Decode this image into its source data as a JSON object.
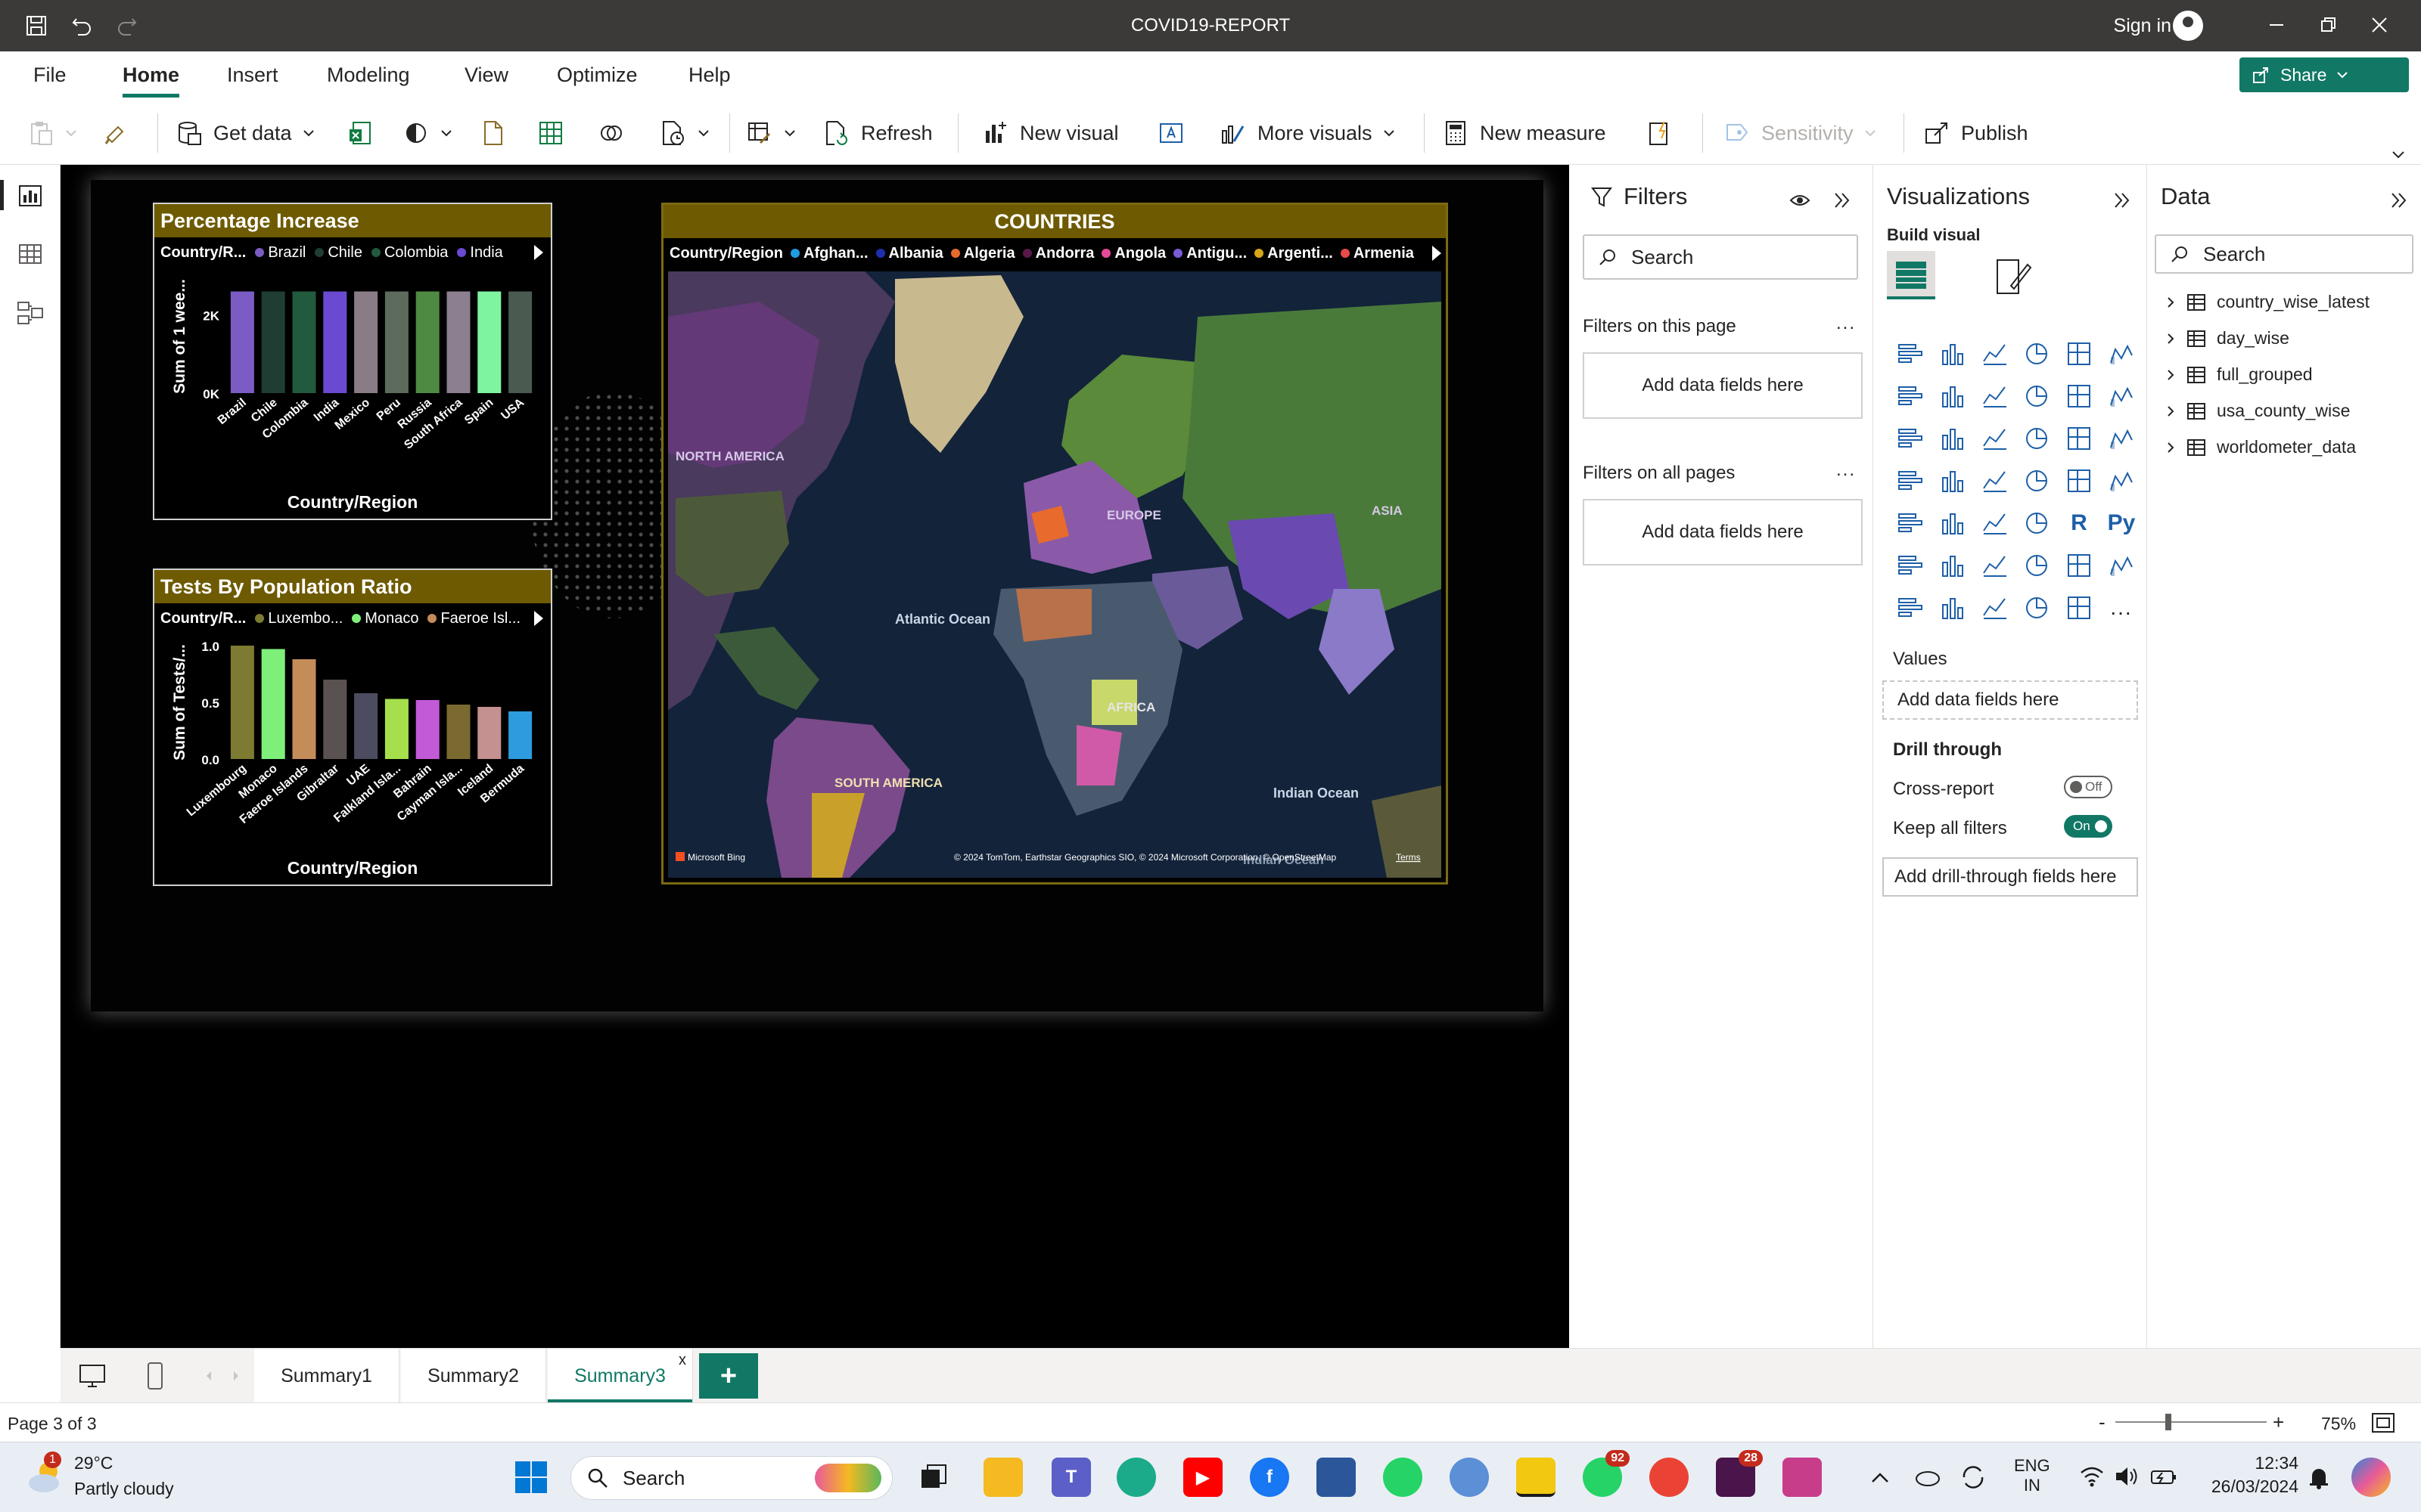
{
  "window": {
    "title": "COVID19-REPORT",
    "sign_in": "Sign in"
  },
  "menu": {
    "tabs": [
      "File",
      "Home",
      "Insert",
      "Modeling",
      "View",
      "Optimize",
      "Help"
    ],
    "active": "Home",
    "share_label": "Share"
  },
  "ribbon": {
    "get_data": "Get data",
    "refresh": "Refresh",
    "new_visual": "New visual",
    "more_visuals": "More visuals",
    "new_measure": "New measure",
    "sensitivity": "Sensitivity",
    "publish": "Publish"
  },
  "visuals": {
    "percentage": {
      "title": "Percentage Increase",
      "legend_title": "Country/R...",
      "legend": [
        {
          "name": "Brazil",
          "color": "#7b5cc4"
        },
        {
          "name": "Chile",
          "color": "#1f3d33"
        },
        {
          "name": "Colombia",
          "color": "#215a3c"
        },
        {
          "name": "India",
          "color": "#6a4ad1"
        }
      ],
      "y_axis_label": "Sum of 1 wee...",
      "x_axis_label": "Country/Region",
      "y_ticks": [
        "2K",
        "0K"
      ]
    },
    "tests": {
      "title": "Tests By Population Ratio",
      "legend_title": "Country/R...",
      "legend": [
        {
          "name": "Luxembo...",
          "color": "#7d7a32"
        },
        {
          "name": "Monaco",
          "color": "#7ef07a"
        },
        {
          "name": "Faeroe Isl...",
          "color": "#c48c59"
        }
      ],
      "y_axis_label": "Sum of Tests/...",
      "x_axis_label": "Country/Region",
      "y_ticks": [
        "1.0",
        "0.5",
        "0.0"
      ]
    },
    "map": {
      "title": "COUNTRIES",
      "legend_title": "Country/Region",
      "legend": [
        {
          "name": "Afghan...",
          "color": "#1f9be0"
        },
        {
          "name": "Albania",
          "color": "#1e2fae"
        },
        {
          "name": "Algeria",
          "color": "#e86a2c"
        },
        {
          "name": "Andorra",
          "color": "#5a1848"
        },
        {
          "name": "Angola",
          "color": "#e84a9a"
        },
        {
          "name": "Antigu...",
          "color": "#7a5ad6"
        },
        {
          "name": "Argenti...",
          "color": "#d4a618"
        },
        {
          "name": "Armenia",
          "color": "#e84a4a"
        }
      ],
      "labels": {
        "north_america": "NORTH AMERICA",
        "europe": "EUROPE",
        "asia": "ASIA",
        "atlantic": "Atlantic Ocean",
        "africa": "AFRICA",
        "south_america": "SOUTH AMERICA",
        "indian": "Indian Ocean",
        "indian2": "Indian Ocean"
      },
      "bing": "Microsoft Bing",
      "attribution": "© 2024 TomTom, Earthstar Geographics SIO, © 2024 Microsoft Corporation, © OpenStreetMap",
      "terms": "Terms"
    }
  },
  "chart_data": [
    {
      "type": "bar",
      "title": "Percentage Increase",
      "xlabel": "Country/Region",
      "ylabel": "Sum of 1 wee...",
      "categories": [
        "Brazil",
        "Chile",
        "Colombia",
        "India",
        "Mexico",
        "Peru",
        "Russia",
        "South Africa",
        "Spain",
        "USA"
      ],
      "values": [
        2600,
        2600,
        2600,
        2600,
        2600,
        2600,
        2600,
        2600,
        2600,
        2600
      ],
      "colors": [
        "#7b5cc4",
        "#1f3d33",
        "#215a3c",
        "#6a4ad1",
        "#8a7c86",
        "#5c6b5c",
        "#4f8a42",
        "#8c7f90",
        "#7ef3a0",
        "#4a5a50"
      ],
      "ylim": [
        0,
        2900
      ]
    },
    {
      "type": "bar",
      "title": "Tests By Population Ratio",
      "xlabel": "Country/Region",
      "ylabel": "Sum of Tests/...",
      "categories": [
        "Luxembourg",
        "Monaco",
        "Faeroe Islands",
        "Gibraltar",
        "UAE",
        "Falkland Isla...",
        "Bahrain",
        "Cayman Isla...",
        "Iceland",
        "Bermuda"
      ],
      "values": [
        1.0,
        0.97,
        0.88,
        0.7,
        0.58,
        0.53,
        0.52,
        0.48,
        0.46,
        0.42
      ],
      "colors": [
        "#7d7a32",
        "#7ef07a",
        "#c48c59",
        "#5a5250",
        "#4c4c60",
        "#a6df4c",
        "#c25ad8",
        "#7a6a30",
        "#c49090",
        "#2e9bde"
      ],
      "ylim": [
        0,
        1.0
      ]
    }
  ],
  "filters": {
    "title": "Filters",
    "search_placeholder": "Search",
    "on_this_page": "Filters on this page",
    "on_all_pages": "Filters on all pages",
    "add_fields": "Add data fields here",
    "more": "..."
  },
  "viz": {
    "title": "Visualizations",
    "build_visual": "Build visual",
    "values": "Values",
    "add_fields": "Add data fields here",
    "drill_through": "Drill through",
    "cross_report": "Cross-report",
    "cross_report_state": "Off",
    "keep_filters": "Keep all filters",
    "keep_filters_state": "On",
    "add_drill": "Add drill-through fields here",
    "r_label": "R",
    "py_label": "Py",
    "more_label": "..."
  },
  "data": {
    "title": "Data",
    "search_placeholder": "Search",
    "tables": [
      "country_wise_latest",
      "day_wise",
      "full_grouped",
      "usa_county_wise",
      "worldometer_data"
    ]
  },
  "pages": {
    "tabs": [
      "Summary1",
      "Summary2",
      "Summary3"
    ],
    "active": "Summary3",
    "close": "x",
    "add": "+"
  },
  "status": {
    "page": "Page 3 of 3",
    "zoom": "75%",
    "minus": "-",
    "plus": "+"
  },
  "taskbar": {
    "temp": "29°C",
    "weather": "Partly cloudy",
    "weather_badge": "1",
    "search": "Search",
    "whatsapp_badge": "92",
    "slack_badge": "28",
    "lang1": "ENG",
    "lang2": "IN",
    "time": "12:34",
    "date": "26/03/2024"
  }
}
